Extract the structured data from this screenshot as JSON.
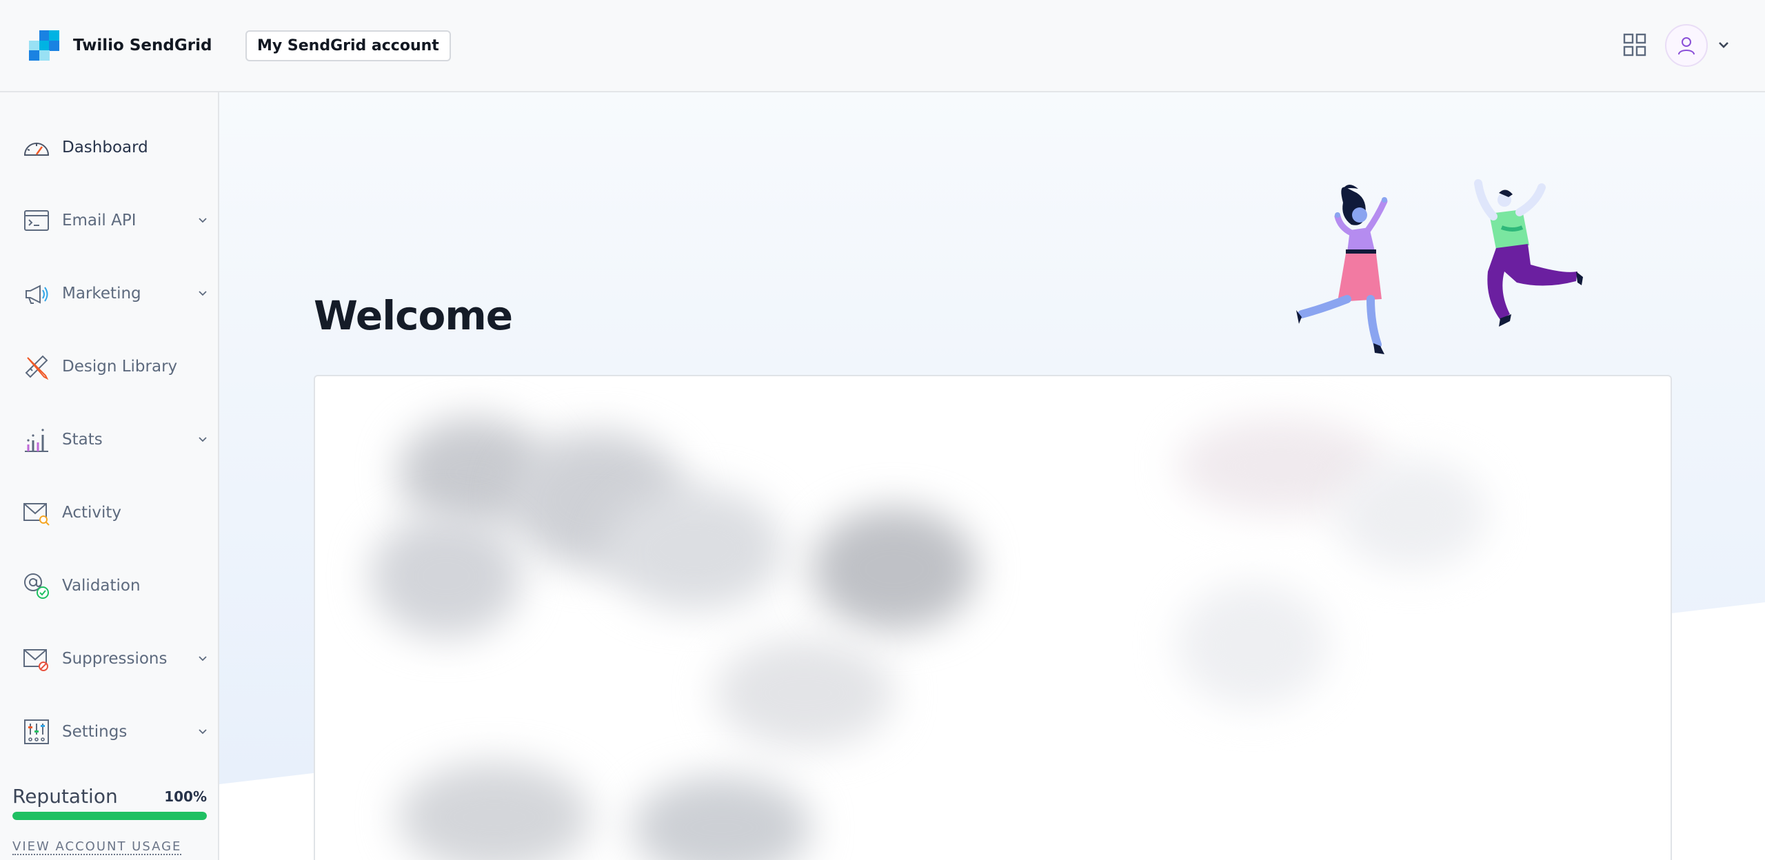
{
  "header": {
    "brand_name": "Twilio SendGrid",
    "account_button": "My SendGrid account",
    "apps_icon": "grid-icon",
    "avatar_icon": "user-icon"
  },
  "sidebar": {
    "items": [
      {
        "label": "Dashboard",
        "icon": "gauge-icon",
        "has_submenu": false,
        "active": true
      },
      {
        "label": "Email API",
        "icon": "terminal-window-icon",
        "has_submenu": true
      },
      {
        "label": "Marketing",
        "icon": "megaphone-icon",
        "has_submenu": true
      },
      {
        "label": "Design Library",
        "icon": "pencil-ruler-icon",
        "has_submenu": false
      },
      {
        "label": "Stats",
        "icon": "bar-chart-icon",
        "has_submenu": true
      },
      {
        "label": "Activity",
        "icon": "envelope-search-icon",
        "has_submenu": false
      },
      {
        "label": "Validation",
        "icon": "at-check-icon",
        "has_submenu": false
      },
      {
        "label": "Suppressions",
        "icon": "envelope-block-icon",
        "has_submenu": true
      },
      {
        "label": "Settings",
        "icon": "sliders-icon",
        "has_submenu": true
      }
    ],
    "reputation": {
      "title": "Reputation",
      "value_text": "100%",
      "value": 1.0
    },
    "usage_link": "VIEW ACCOUNT USAGE"
  },
  "main": {
    "title": "Welcome"
  },
  "colors": {
    "brand_dark_blue": "#1a82e2",
    "brand_light_blue": "#00b3e3",
    "reputation_green": "#1fc062",
    "text_dark": "#151c28",
    "nav_text": "#5d6a7e"
  }
}
